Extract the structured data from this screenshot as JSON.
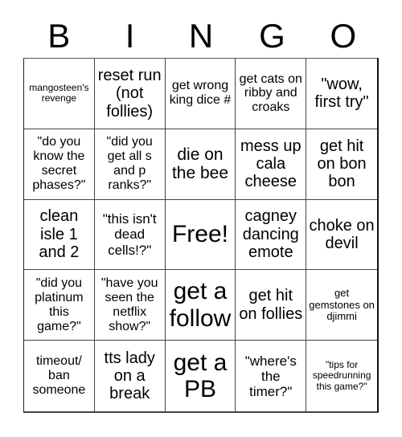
{
  "header": {
    "letters": [
      "B",
      "I",
      "N",
      "G",
      "O"
    ]
  },
  "cells": [
    "mangosteen's revenge",
    "reset run (not follies)",
    "get wrong king dice #",
    "get cats on ribby and croaks",
    "\"wow, first try\"",
    "\"do you know the secret phases?\"",
    "\"did you get all s and p ranks?\"",
    "die on the bee",
    "mess up cala cheese",
    "get hit on bon bon",
    "clean isle 1 and 2",
    "\"this isn't dead cells!?\"",
    "Free!",
    "cagney dancing emote",
    "choke on devil",
    "\"did you platinum this game?\"",
    "\"have you seen the netflix show?\"",
    "get a follow",
    "get hit on follies",
    "get gemstones on djimmi",
    "timeout/ ban someone",
    "tts lady on a break",
    "get a PB",
    "\"where's the timer?\"",
    "\"tips for speedrunning this game?\""
  ]
}
